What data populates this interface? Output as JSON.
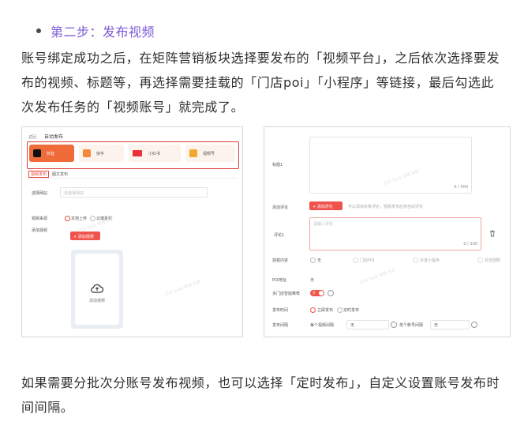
{
  "step_heading": "第二步：发布视频",
  "paragraph1": "账号绑定成功之后，在矩阵营销板块选择要发布的「视频平台」，之后依次选择要发布的视频、标题等，再选择需要挂载的「门店poi」「小程序」等链接，最后勾选此次发布任务的「视频账号」就完成了。",
  "paragraph2": "如果需要分批次分账号发布视频，也可以选择「定时发布」，自定义设置账号发布时间间隔。",
  "shot_left": {
    "breadcrumb": "返回",
    "title": "自动发布",
    "platforms": [
      "抖音",
      "快手",
      "小红书",
      "视频号"
    ],
    "tabs": [
      "视频发布",
      "图文发布"
    ],
    "select_label": "选择网站",
    "select_placeholder": "请选择网站",
    "source_label": "视频来源",
    "source_options": [
      "本地上传",
      "云端素材"
    ],
    "add_label": "添加视频",
    "add_button": "+ 添加视频",
    "upload_text": "添加视频",
    "watermark": "日讯 SaaS 营销 系统"
  },
  "shot_right": {
    "title_label": "标题1",
    "title_counter": "0 / 500",
    "comment_label": "添加评论",
    "comment_button": "+ 添加评论",
    "comment_hint": "可以添加多条评论，视频发布后将自动评论",
    "comment1_label": "评论1",
    "comment1_placeholder": "请输入评论",
    "comment1_counter": "0 / 100",
    "mount_label": "挂载内容",
    "mount_options": [
      "无",
      "门店POI",
      "抖音小程序",
      "抖音团购"
    ],
    "poi_label": "POI地址",
    "poi_value": "无",
    "store_label": "多门店智能推荐",
    "store_toggle": "开",
    "publish_time_label": "发布时间",
    "publish_time_options": [
      "立即发布",
      "定时发布"
    ],
    "interval_label": "发布间隔",
    "interval_per_video": "每个视频间隔",
    "interval_per_video_value": "无",
    "interval_per_account": "单个账号间隔",
    "interval_per_account_value": "无",
    "watermark": "日讯 SaaS 营销 系统"
  }
}
